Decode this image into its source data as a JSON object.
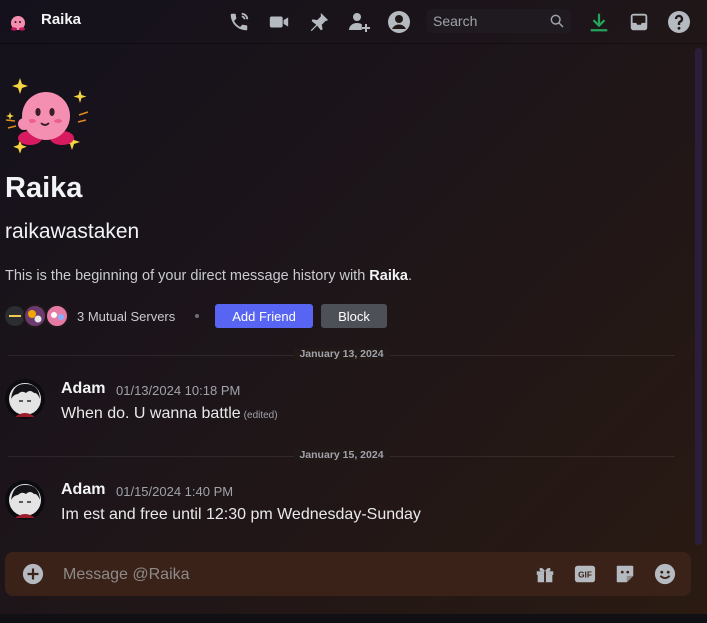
{
  "header": {
    "title": "Raika",
    "search_placeholder": "Search",
    "icons": [
      "phone-call-icon",
      "video-call-icon",
      "pin-icon",
      "add-friend-icon",
      "user-profile-icon",
      "download-icon",
      "inbox-icon",
      "help-icon"
    ],
    "download_color": "#23a55a"
  },
  "profile": {
    "display_name": "Raika",
    "username": "raikawastaken",
    "intro_prefix": "This is the beginning of your direct message history with ",
    "intro_name": "Raika",
    "intro_suffix": ".",
    "mutual_servers": "3 Mutual Servers",
    "add_friend_label": "Add Friend",
    "block_label": "Block"
  },
  "messages": [
    {
      "date_divider": "January 13, 2024",
      "author": "Adam",
      "timestamp": "01/13/2024 10:18 PM",
      "text": "When do. U wanna battle",
      "edited": "(edited)"
    },
    {
      "date_divider": "January 15, 2024",
      "author": "Adam",
      "timestamp": "01/15/2024 1:40 PM",
      "text": "Im est and free until 12:30 pm Wednesday-Sunday",
      "edited": ""
    }
  ],
  "composer": {
    "placeholder": "Message @Raika",
    "gif_label": "GIF",
    "icons": [
      "add-attachment-icon",
      "gift-icon",
      "gif-icon",
      "sticker-icon",
      "emoji-icon"
    ]
  },
  "colors": {
    "accent": "#5865f2",
    "block_button": "#4e5058",
    "avatar_pink": "#f48fb1"
  }
}
